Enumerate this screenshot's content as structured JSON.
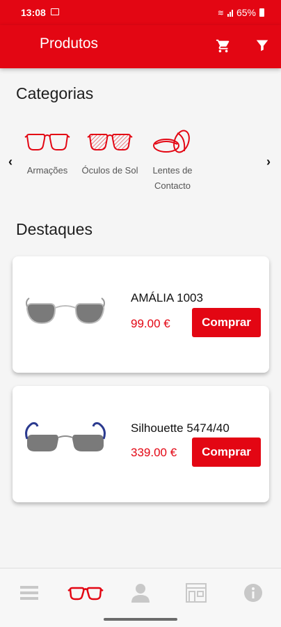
{
  "status_bar": {
    "time": "13:08",
    "battery": "65%"
  },
  "header": {
    "title": "Produtos",
    "cart_icon": "cart-icon",
    "filter_icon": "filter-icon"
  },
  "categories": {
    "title": "Categorias",
    "prev_arrow": "‹",
    "next_arrow": "›",
    "items": [
      {
        "label": "Armações",
        "icon": "frames-icon"
      },
      {
        "label": "Óculos de Sol",
        "icon": "sunglasses-icon"
      },
      {
        "label": "Lentes de Contacto",
        "icon": "contact-lenses-icon"
      }
    ]
  },
  "highlights": {
    "title": "Destaques",
    "products": [
      {
        "name": "AMÁLIA 1003",
        "price": "99.00 €",
        "buy_label": "Comprar"
      },
      {
        "name": "Silhouette 5474/40",
        "price": "339.00 €",
        "buy_label": "Comprar"
      }
    ]
  },
  "bottom_nav": [
    {
      "icon": "menu-icon",
      "active": false
    },
    {
      "icon": "glasses-icon",
      "active": true
    },
    {
      "icon": "user-icon",
      "active": false
    },
    {
      "icon": "store-icon",
      "active": false
    },
    {
      "icon": "info-icon",
      "active": false
    }
  ],
  "colors": {
    "brand": "#e30613",
    "inactive_icon": "#c8c8c8"
  }
}
